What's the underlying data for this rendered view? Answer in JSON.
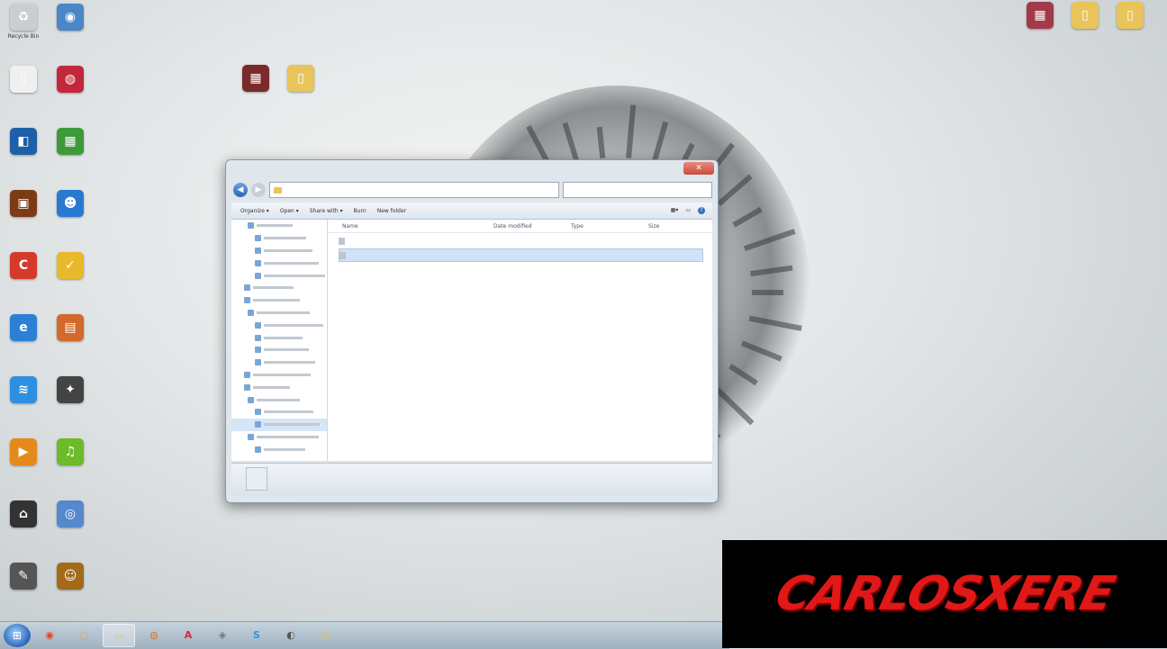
{
  "desktop_icons_left": [
    {
      "id": "recycle",
      "label": "Recycle Bin",
      "color": "#c9ced3",
      "glyph": "♻",
      "icon": "recycle-bin-icon"
    },
    {
      "id": "readerpdf",
      "label": "",
      "color": "#4b86c6",
      "glyph": "◉",
      "icon": "app-icon"
    },
    {
      "id": "file1",
      "label": "",
      "color": "#f0f0f0",
      "glyph": "▯",
      "icon": "file-icon"
    },
    {
      "id": "downloader",
      "label": "",
      "color": "#c2283a",
      "glyph": "◍",
      "icon": "download-icon"
    },
    {
      "id": "dashlane",
      "label": "",
      "color": "#1f5fa8",
      "glyph": "◧",
      "icon": "app-icon"
    },
    {
      "id": "winapp",
      "label": "",
      "color": "#3c9a3a",
      "glyph": "▦",
      "icon": "windows-app-icon"
    },
    {
      "id": "game1",
      "label": "",
      "color": "#7b3c14",
      "glyph": "▣",
      "icon": "game-icon"
    },
    {
      "id": "messenger",
      "label": "",
      "color": "#2a79d1",
      "glyph": "☻",
      "icon": "messenger-icon"
    },
    {
      "id": "ccleaner",
      "label": "",
      "color": "#d43a2a",
      "glyph": "C",
      "icon": "ccleaner-icon"
    },
    {
      "id": "norton",
      "label": "",
      "color": "#e8b92a",
      "glyph": "✓",
      "icon": "security-icon"
    },
    {
      "id": "ie",
      "label": "",
      "color": "#2c7fd6",
      "glyph": "e",
      "icon": "browser-icon"
    },
    {
      "id": "office",
      "label": "",
      "color": "#d16a2a",
      "glyph": "▤",
      "icon": "office-icon"
    },
    {
      "id": "mobile",
      "label": "",
      "color": "#2e8fe0",
      "glyph": "≋",
      "icon": "wireless-icon"
    },
    {
      "id": "wizard",
      "label": "",
      "color": "#444",
      "glyph": "✦",
      "icon": "tool-icon"
    },
    {
      "id": "player",
      "label": "",
      "color": "#e58a1a",
      "glyph": "▶",
      "icon": "media-player-icon"
    },
    {
      "id": "spotify",
      "label": "",
      "color": "#6cbb2a",
      "glyph": "♫",
      "icon": "spotify-icon"
    },
    {
      "id": "home",
      "label": "",
      "color": "#333",
      "glyph": "⌂",
      "icon": "home-icon"
    },
    {
      "id": "globe",
      "label": "",
      "color": "#5588cc",
      "glyph": "◎",
      "icon": "globe-icon"
    },
    {
      "id": "tools",
      "label": "",
      "color": "#555",
      "glyph": "✎",
      "icon": "tools-icon"
    },
    {
      "id": "smiley",
      "label": "",
      "color": "#a36a1a",
      "glyph": "☺",
      "icon": "app-icon"
    }
  ],
  "desktop_icons_mid": [
    {
      "id": "ms1",
      "label": "",
      "color": "#7a2a2a",
      "glyph": "▦",
      "icon": "app-icon"
    },
    {
      "id": "ms2",
      "label": "",
      "color": "#e8c45a",
      "glyph": "▯",
      "icon": "folder-icon"
    }
  ],
  "desktop_icons_right": [
    {
      "id": "r1",
      "label": "",
      "color": "#a33a4a",
      "glyph": "▦",
      "icon": "app-icon"
    },
    {
      "id": "r2",
      "label": "",
      "color": "#e8c45a",
      "glyph": "▯",
      "icon": "folder-icon"
    },
    {
      "id": "r3",
      "label": "",
      "color": "#e8c45a",
      "glyph": "▯",
      "icon": "folder-icon"
    }
  ],
  "explorer": {
    "close": "✕",
    "back": "◀",
    "forward": "▶",
    "address_segments": [
      "",
      "",
      ""
    ],
    "search_placeholder": "",
    "toolbar": [
      "Organize ▾",
      "Open ▾",
      "Share with ▾",
      "Burn",
      "New folder"
    ],
    "nav_items": [],
    "columns": [
      "Name",
      "Date modified",
      "Type",
      "Size"
    ],
    "files": [
      {
        "name": "",
        "date": "",
        "type": "",
        "size": "",
        "selected": false
      },
      {
        "name": "",
        "date": "",
        "type": "",
        "size": "",
        "selected": true
      }
    ],
    "status_line1": "",
    "status_line2": ""
  },
  "taskbar": {
    "start_glyph": "⊞",
    "buttons": [
      {
        "id": "chrome",
        "glyph": "◉",
        "color": "#d84a2a",
        "icon": "chrome-icon",
        "active": false
      },
      {
        "id": "opera",
        "glyph": "○",
        "color": "#e2a05a",
        "icon": "browser-icon",
        "active": false
      },
      {
        "id": "explorer",
        "glyph": "▭",
        "color": "#e8c45a",
        "icon": "folder-icon",
        "active": true
      },
      {
        "id": "firefox",
        "glyph": "◍",
        "color": "#e0742a",
        "icon": "firefox-icon",
        "active": false
      },
      {
        "id": "adobe",
        "glyph": "A",
        "color": "#d42a2a",
        "icon": "adobe-icon",
        "active": false
      },
      {
        "id": "vlc",
        "glyph": "◈",
        "color": "#777",
        "icon": "app-icon",
        "active": false
      },
      {
        "id": "skype",
        "glyph": "S",
        "color": "#2a9ae0",
        "icon": "skype-icon",
        "active": false
      },
      {
        "id": "misc",
        "glyph": "◐",
        "color": "#555",
        "icon": "app-icon",
        "active": false
      },
      {
        "id": "notes",
        "glyph": "▤",
        "color": "#d8c46a",
        "icon": "notes-icon",
        "active": false
      }
    ]
  },
  "watermark": {
    "text": "CARLOSXERE"
  }
}
